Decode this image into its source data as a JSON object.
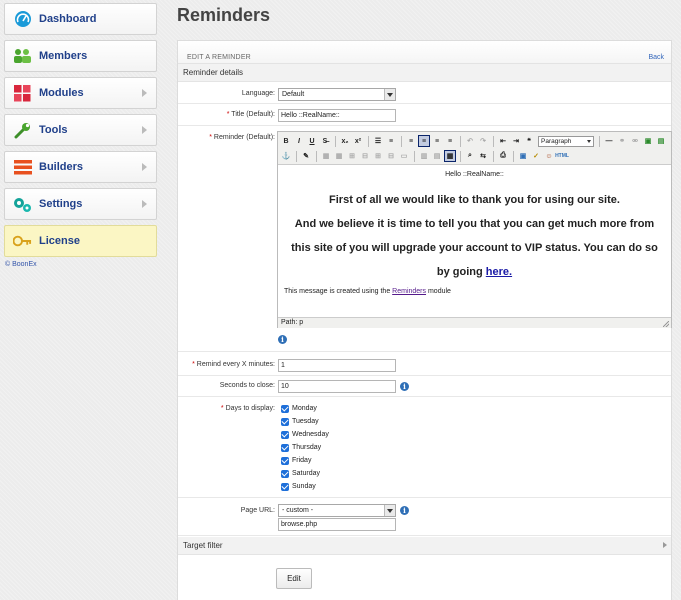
{
  "sidebar": {
    "items": [
      {
        "label": "Dashboard",
        "icon": "dashboard-gauge-icon",
        "has_arrow": false,
        "active": false
      },
      {
        "label": "Members",
        "icon": "members-group-icon",
        "has_arrow": false,
        "active": false
      },
      {
        "label": "Modules",
        "icon": "modules-grid-icon",
        "has_arrow": true,
        "active": false
      },
      {
        "label": "Tools",
        "icon": "wrench-icon",
        "has_arrow": true,
        "active": false
      },
      {
        "label": "Builders",
        "icon": "builders-bars-icon",
        "has_arrow": true,
        "active": false
      },
      {
        "label": "Settings",
        "icon": "gears-icon",
        "has_arrow": true,
        "active": false
      },
      {
        "label": "License",
        "icon": "key-icon",
        "has_arrow": false,
        "active": true
      }
    ],
    "copyright": "© BoonEx"
  },
  "page": {
    "title": "Reminders"
  },
  "panel": {
    "caption": "EDIT A REMINDER",
    "back_label": "Back",
    "section_title": "Reminder details",
    "target_filter_label": "Target filter"
  },
  "form": {
    "language": {
      "label": "Language:",
      "value": "Default"
    },
    "title": {
      "label": "Title (Default):",
      "value": "Hello ::RealName::"
    },
    "reminder": {
      "label": "Reminder (Default):",
      "toolbar": {
        "paragraph_format": "Paragraph"
      },
      "content": {
        "greeting": "Hello ::RealName::",
        "line1": "First of all we would like to thank you for using our site.",
        "line2": "And we believe it is time to tell you that you can get much more from this site of you will upgrade your account to VIP status. You can do so by going",
        "link_text": "here.",
        "footer_prefix": "This message is created using the ",
        "footer_link": "Reminders",
        "footer_suffix": " module"
      },
      "status_path": "Path: p"
    },
    "remind_every": {
      "label": "Remind every X minutes:",
      "value": "1"
    },
    "seconds_to_close": {
      "label": "Seconds to close:",
      "value": "10"
    },
    "days": {
      "label": "Days to display:",
      "options": [
        {
          "label": "Monday",
          "checked": true
        },
        {
          "label": "Tuesday",
          "checked": true
        },
        {
          "label": "Wednesday",
          "checked": true
        },
        {
          "label": "Thursday",
          "checked": true
        },
        {
          "label": "Friday",
          "checked": true
        },
        {
          "label": "Saturday",
          "checked": true
        },
        {
          "label": "Sunday",
          "checked": true
        }
      ]
    },
    "page_url": {
      "label": "Page URL:",
      "select_value": "- custom -",
      "custom_value": "browse.php"
    },
    "submit_label": "Edit"
  },
  "colors": {
    "accent": "#20408a",
    "required": "#cc0000",
    "checkbox": "#1e6fd9",
    "active_nav": "#fbf6c4"
  }
}
